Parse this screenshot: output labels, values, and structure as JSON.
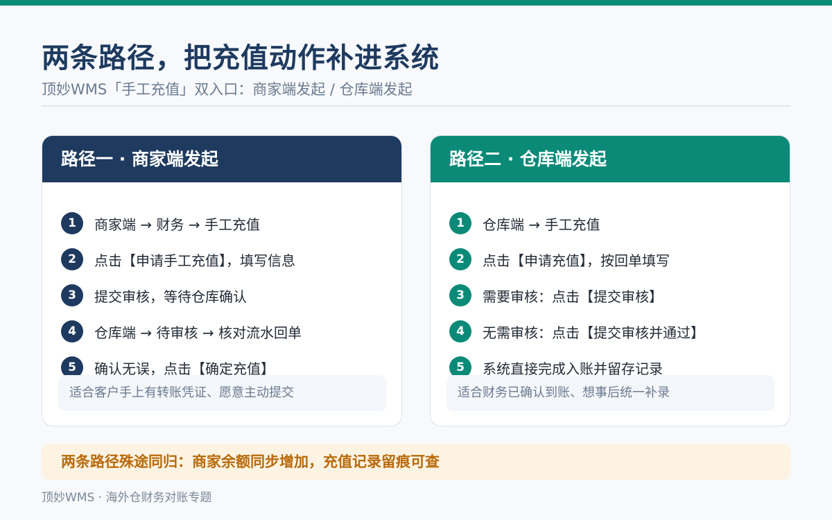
{
  "title": "两条路径，把充值动作补进系统",
  "subtitle": "顶妙WMS「手工充值」双入口：商家端发起 / 仓库端发起",
  "colors": {
    "navy": "#1e3a5f",
    "teal": "#0b8a78",
    "summary_bg": "#fdf3e3",
    "summary_text": "#b86a0a"
  },
  "cards": [
    {
      "title": "路径一 · 商家端发起",
      "steps": [
        {
          "num": "1",
          "text": "商家端 → 财务 → 手工充值"
        },
        {
          "num": "2",
          "text": "点击【申请手工充值】，填写信息"
        },
        {
          "num": "3",
          "text": "提交审核，等待仓库确认"
        },
        {
          "num": "4",
          "text": "仓库端 → 待审核 → 核对流水回单"
        },
        {
          "num": "5",
          "text": "确认无误，点击【确定充值】"
        }
      ],
      "note": "适合客户手上有转账凭证、愿意主动提交"
    },
    {
      "title": "路径二 · 仓库端发起",
      "steps": [
        {
          "num": "1",
          "text": "仓库端 → 手工充值"
        },
        {
          "num": "2",
          "text": "点击【申请充值】，按回单填写"
        },
        {
          "num": "3",
          "text": "需要审核：点击【提交审核】"
        },
        {
          "num": "4",
          "text": "无需审核：点击【提交审核并通过】"
        },
        {
          "num": "5",
          "text": "系统直接完成入账并留存记录"
        }
      ],
      "note": "适合财务已确认到账、想事后统一补录"
    }
  ],
  "summary": "两条路径殊途同归：商家余额同步增加，充值记录留痕可查",
  "footer": "顶妙WMS · 海外仓财务对账专题"
}
